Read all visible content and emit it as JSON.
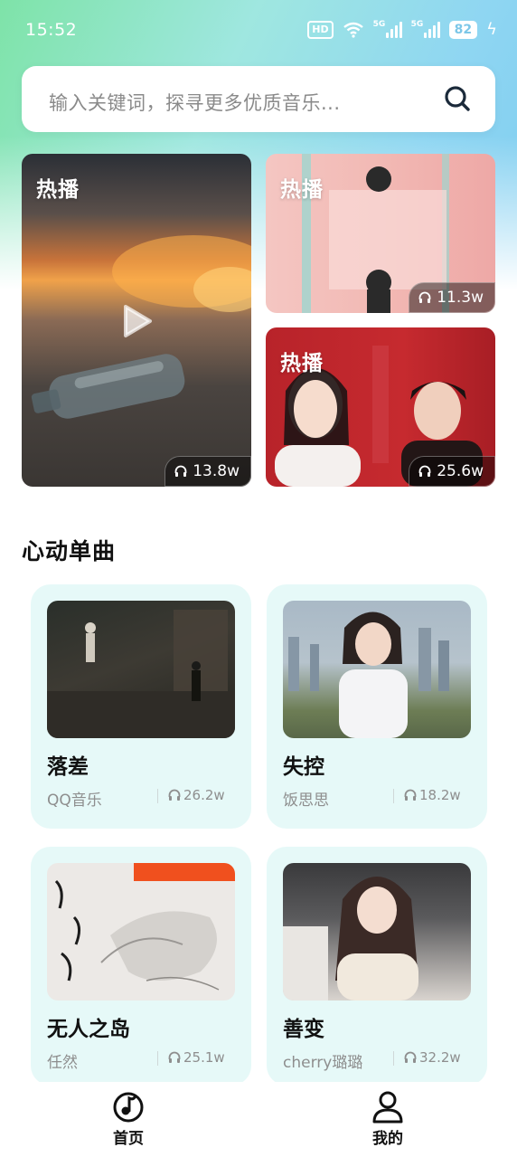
{
  "status_bar": {
    "time": "15:52",
    "hd": "HD",
    "signal1_tag": "5G",
    "signal2_tag": "5G",
    "battery": "82"
  },
  "search": {
    "placeholder": "输入关键词，探寻更多优质音乐..."
  },
  "hot": [
    {
      "label": "热播",
      "plays": "13.8w"
    },
    {
      "label": "热播",
      "plays": "11.3w"
    },
    {
      "label": "热播",
      "plays": "25.6w"
    }
  ],
  "section": {
    "title": "心动单曲"
  },
  "songs": [
    {
      "title": "落差",
      "artist": "QQ音乐",
      "plays": "26.2w"
    },
    {
      "title": "失控",
      "artist": "饭思思",
      "plays": "18.2w"
    },
    {
      "title": "无人之岛",
      "artist": "任然",
      "plays": "25.1w"
    },
    {
      "title": "善变",
      "artist": "cherry璐璐",
      "plays": "32.2w"
    }
  ],
  "nav": {
    "home": "首页",
    "mine": "我的"
  },
  "colors": {
    "accent_gradient_start": "#7ee3a8",
    "accent_gradient_end": "#7fcdf0",
    "card_bg": "#e6f9f8"
  }
}
